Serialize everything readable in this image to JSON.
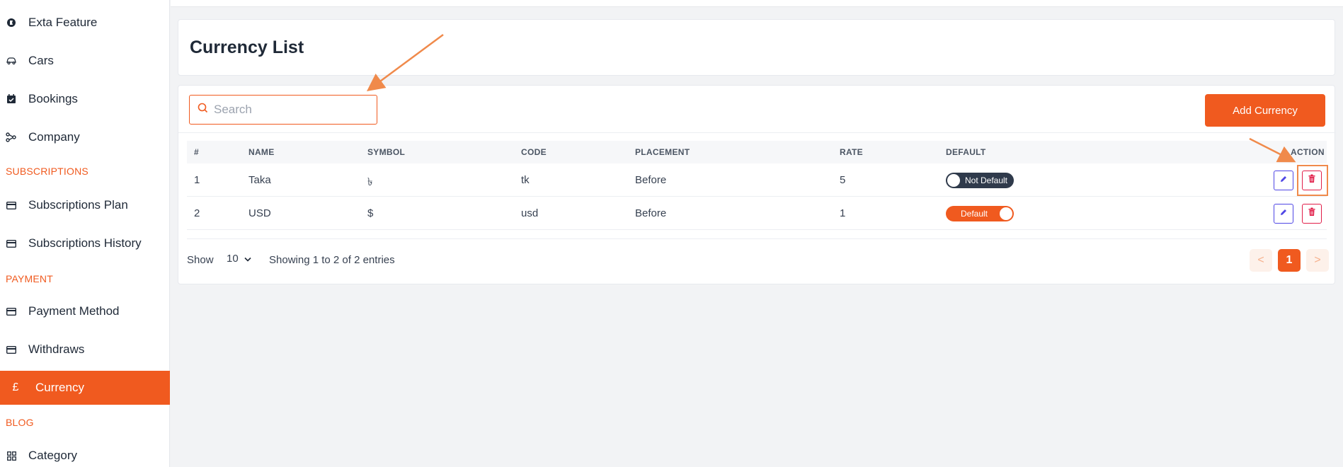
{
  "sidebar": {
    "items": [
      {
        "label": "Exta Feature",
        "icon": "circle-badge-icon"
      },
      {
        "label": "Cars",
        "icon": "car-icon"
      },
      {
        "label": "Bookings",
        "icon": "calendar-check-icon"
      },
      {
        "label": "Company",
        "icon": "network-icon"
      },
      {
        "label": "Subscriptions Plan",
        "icon": "card-icon"
      },
      {
        "label": "Subscriptions History",
        "icon": "card-icon"
      },
      {
        "label": "Payment Method",
        "icon": "card-icon"
      },
      {
        "label": "Withdraws",
        "icon": "card-icon"
      },
      {
        "label": "Currency",
        "icon": "pound-icon",
        "glyph": "£"
      },
      {
        "label": "Category",
        "icon": "grid-icon"
      }
    ],
    "sections": [
      "SUBSCRIPTIONS",
      "PAYMENT",
      "BLOG"
    ]
  },
  "page": {
    "title": "Currency List"
  },
  "toolbar": {
    "search_placeholder": "Search",
    "search_value": "",
    "add_label": "Add Currency"
  },
  "table": {
    "headers": [
      "#",
      "NAME",
      "SYMBOL",
      "CODE",
      "PLACEMENT",
      "RATE",
      "DEFAULT",
      "ACTION"
    ],
    "rows": [
      {
        "num": "1",
        "name": "Taka",
        "symbol": "৳",
        "code": "tk",
        "placement": "Before",
        "rate": "5",
        "default_label": "Not Default",
        "is_default": false
      },
      {
        "num": "2",
        "name": "USD",
        "symbol": "$",
        "code": "usd",
        "placement": "Before",
        "rate": "1",
        "default_label": "Default",
        "is_default": true
      }
    ]
  },
  "footer": {
    "show_label": "Show",
    "page_size": "10",
    "entries_text": "Showing 1 to 2 of 2 entries"
  },
  "pagination": {
    "prev": "<",
    "current": "1",
    "next": ">"
  },
  "colors": {
    "accent": "#f05a1f",
    "edit": "#4f46e5",
    "delete": "#e11d48",
    "annotation": "#f08a4b"
  }
}
